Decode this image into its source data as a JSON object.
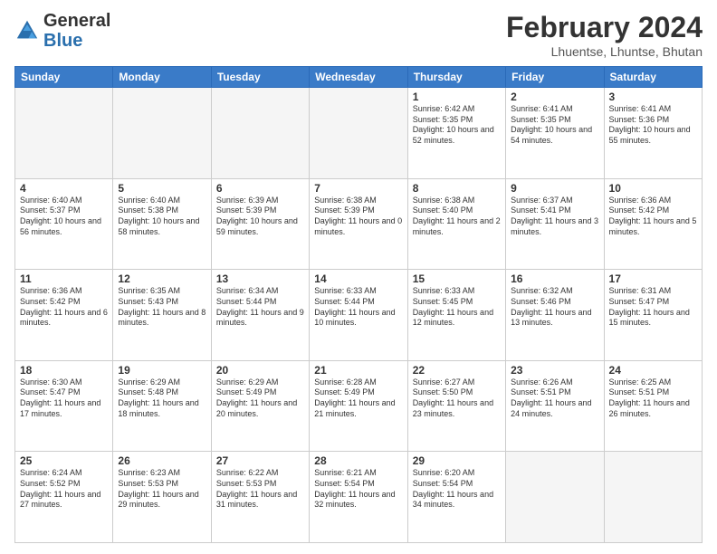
{
  "header": {
    "logo_general": "General",
    "logo_blue": "Blue",
    "month_year": "February 2024",
    "location": "Lhuentse, Lhuntse, Bhutan"
  },
  "days_of_week": [
    "Sunday",
    "Monday",
    "Tuesday",
    "Wednesday",
    "Thursday",
    "Friday",
    "Saturday"
  ],
  "weeks": [
    [
      {
        "day": "",
        "info": ""
      },
      {
        "day": "",
        "info": ""
      },
      {
        "day": "",
        "info": ""
      },
      {
        "day": "",
        "info": ""
      },
      {
        "day": "1",
        "info": "Sunrise: 6:42 AM\nSunset: 5:35 PM\nDaylight: 10 hours and 52 minutes."
      },
      {
        "day": "2",
        "info": "Sunrise: 6:41 AM\nSunset: 5:35 PM\nDaylight: 10 hours and 54 minutes."
      },
      {
        "day": "3",
        "info": "Sunrise: 6:41 AM\nSunset: 5:36 PM\nDaylight: 10 hours and 55 minutes."
      }
    ],
    [
      {
        "day": "4",
        "info": "Sunrise: 6:40 AM\nSunset: 5:37 PM\nDaylight: 10 hours and 56 minutes."
      },
      {
        "day": "5",
        "info": "Sunrise: 6:40 AM\nSunset: 5:38 PM\nDaylight: 10 hours and 58 minutes."
      },
      {
        "day": "6",
        "info": "Sunrise: 6:39 AM\nSunset: 5:39 PM\nDaylight: 10 hours and 59 minutes."
      },
      {
        "day": "7",
        "info": "Sunrise: 6:38 AM\nSunset: 5:39 PM\nDaylight: 11 hours and 0 minutes."
      },
      {
        "day": "8",
        "info": "Sunrise: 6:38 AM\nSunset: 5:40 PM\nDaylight: 11 hours and 2 minutes."
      },
      {
        "day": "9",
        "info": "Sunrise: 6:37 AM\nSunset: 5:41 PM\nDaylight: 11 hours and 3 minutes."
      },
      {
        "day": "10",
        "info": "Sunrise: 6:36 AM\nSunset: 5:42 PM\nDaylight: 11 hours and 5 minutes."
      }
    ],
    [
      {
        "day": "11",
        "info": "Sunrise: 6:36 AM\nSunset: 5:42 PM\nDaylight: 11 hours and 6 minutes."
      },
      {
        "day": "12",
        "info": "Sunrise: 6:35 AM\nSunset: 5:43 PM\nDaylight: 11 hours and 8 minutes."
      },
      {
        "day": "13",
        "info": "Sunrise: 6:34 AM\nSunset: 5:44 PM\nDaylight: 11 hours and 9 minutes."
      },
      {
        "day": "14",
        "info": "Sunrise: 6:33 AM\nSunset: 5:44 PM\nDaylight: 11 hours and 10 minutes."
      },
      {
        "day": "15",
        "info": "Sunrise: 6:33 AM\nSunset: 5:45 PM\nDaylight: 11 hours and 12 minutes."
      },
      {
        "day": "16",
        "info": "Sunrise: 6:32 AM\nSunset: 5:46 PM\nDaylight: 11 hours and 13 minutes."
      },
      {
        "day": "17",
        "info": "Sunrise: 6:31 AM\nSunset: 5:47 PM\nDaylight: 11 hours and 15 minutes."
      }
    ],
    [
      {
        "day": "18",
        "info": "Sunrise: 6:30 AM\nSunset: 5:47 PM\nDaylight: 11 hours and 17 minutes."
      },
      {
        "day": "19",
        "info": "Sunrise: 6:29 AM\nSunset: 5:48 PM\nDaylight: 11 hours and 18 minutes."
      },
      {
        "day": "20",
        "info": "Sunrise: 6:29 AM\nSunset: 5:49 PM\nDaylight: 11 hours and 20 minutes."
      },
      {
        "day": "21",
        "info": "Sunrise: 6:28 AM\nSunset: 5:49 PM\nDaylight: 11 hours and 21 minutes."
      },
      {
        "day": "22",
        "info": "Sunrise: 6:27 AM\nSunset: 5:50 PM\nDaylight: 11 hours and 23 minutes."
      },
      {
        "day": "23",
        "info": "Sunrise: 6:26 AM\nSunset: 5:51 PM\nDaylight: 11 hours and 24 minutes."
      },
      {
        "day": "24",
        "info": "Sunrise: 6:25 AM\nSunset: 5:51 PM\nDaylight: 11 hours and 26 minutes."
      }
    ],
    [
      {
        "day": "25",
        "info": "Sunrise: 6:24 AM\nSunset: 5:52 PM\nDaylight: 11 hours and 27 minutes."
      },
      {
        "day": "26",
        "info": "Sunrise: 6:23 AM\nSunset: 5:53 PM\nDaylight: 11 hours and 29 minutes."
      },
      {
        "day": "27",
        "info": "Sunrise: 6:22 AM\nSunset: 5:53 PM\nDaylight: 11 hours and 31 minutes."
      },
      {
        "day": "28",
        "info": "Sunrise: 6:21 AM\nSunset: 5:54 PM\nDaylight: 11 hours and 32 minutes."
      },
      {
        "day": "29",
        "info": "Sunrise: 6:20 AM\nSunset: 5:54 PM\nDaylight: 11 hours and 34 minutes."
      },
      {
        "day": "",
        "info": ""
      },
      {
        "day": "",
        "info": ""
      }
    ]
  ]
}
